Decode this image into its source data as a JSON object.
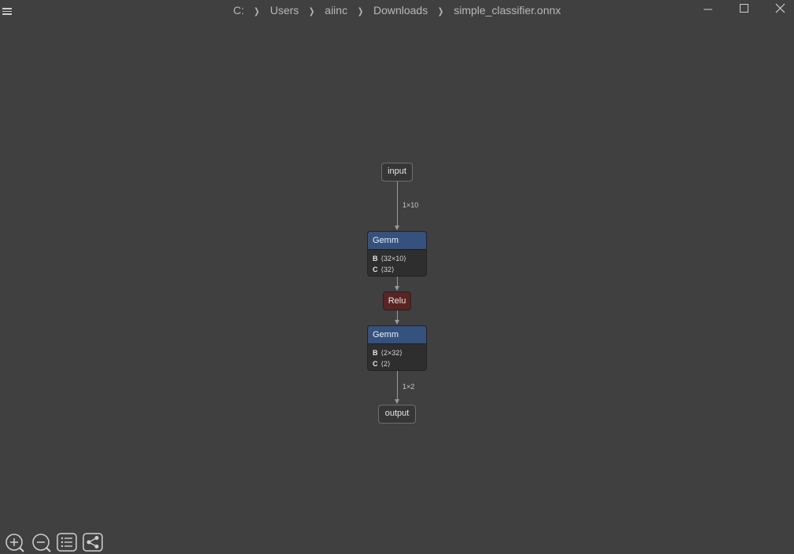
{
  "titlebar": {
    "breadcrumb": [
      "C:",
      "Users",
      "aiinc",
      "Downloads",
      "simple_classifier.onnx"
    ],
    "separator": "❯"
  },
  "graph": {
    "input_node": "input",
    "output_node": "output",
    "edge_input_label": "1×10",
    "edge_output_label": "1×2",
    "gemm1": {
      "title": "Gemm",
      "attrs": [
        {
          "key": "B",
          "value": "⟨32×10⟩"
        },
        {
          "key": "C",
          "value": "⟨32⟩"
        }
      ]
    },
    "relu": {
      "title": "Relu"
    },
    "gemm2": {
      "title": "Gemm",
      "attrs": [
        {
          "key": "B",
          "value": "⟨2×32⟩"
        },
        {
          "key": "C",
          "value": "⟨2⟩"
        }
      ]
    }
  },
  "colors": {
    "background": "#404040",
    "gemm_header": "#35517d",
    "relu": "#5a2422",
    "edge": "#9a9a9a"
  },
  "toolbar": {
    "icons": [
      "zoom-in-icon",
      "zoom-out-icon",
      "list-icon",
      "share-icon"
    ]
  }
}
